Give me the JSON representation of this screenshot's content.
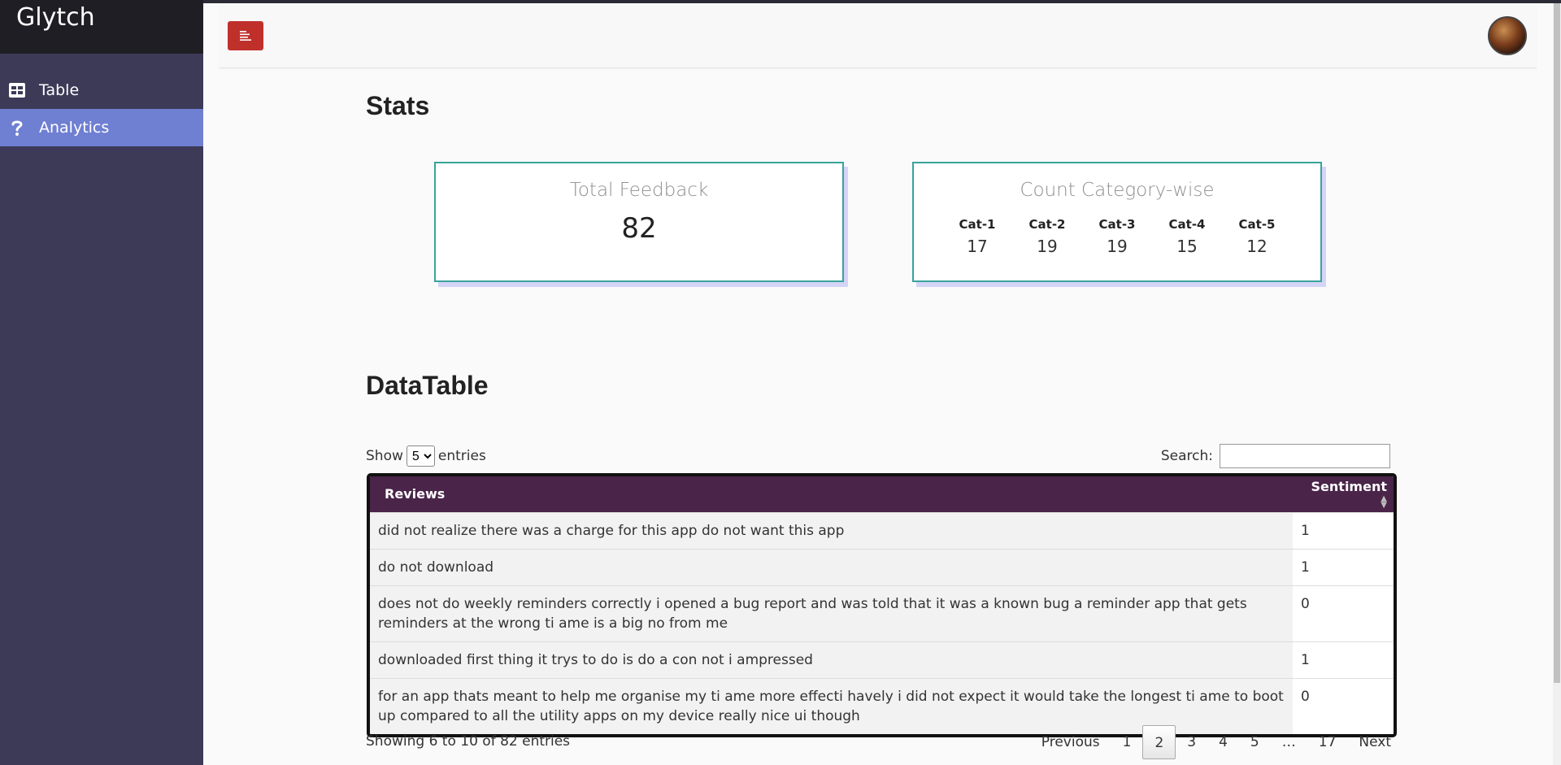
{
  "app": {
    "brand": "Glytch"
  },
  "sidebar": {
    "items": [
      {
        "label": "Table",
        "icon": "table-icon",
        "active": false
      },
      {
        "label": "Analytics",
        "icon": "question-icon",
        "active": true
      }
    ]
  },
  "stats": {
    "title": "Stats",
    "total_feedback": {
      "title": "Total Feedback",
      "value": "82"
    },
    "category": {
      "title": "Count Category-wise",
      "items": [
        {
          "label": "Cat-1",
          "value": "17"
        },
        {
          "label": "Cat-2",
          "value": "19"
        },
        {
          "label": "Cat-3",
          "value": "19"
        },
        {
          "label": "Cat-4",
          "value": "15"
        },
        {
          "label": "Cat-5",
          "value": "12"
        }
      ]
    }
  },
  "datatable": {
    "title": "DataTable",
    "show_label": "Show",
    "entries_label": "entries",
    "page_length": "5",
    "page_length_options": [
      "5"
    ],
    "search_label": "Search:",
    "search_value": "",
    "columns": [
      "Reviews",
      "Sentiment"
    ],
    "rows": [
      {
        "review": "did not realize there was a charge for this app do not want this app",
        "sentiment": "1"
      },
      {
        "review": "do not download",
        "sentiment": "1"
      },
      {
        "review": "does not do weekly reminders correctly i opened a bug report and was told that it was a known bug a reminder app that gets reminders at the wrong ti ame is a big no from me",
        "sentiment": "0"
      },
      {
        "review": "downloaded first thing it trys to do is do a con not i ampressed",
        "sentiment": "1"
      },
      {
        "review": "for an app thats meant to help me organise my ti ame more effecti havely i did not expect it would take the longest ti ame to boot up compared to all the utility apps on my device really nice ui though",
        "sentiment": "0"
      }
    ],
    "info": "Showing 6 to 10 of 82 entries",
    "pagination": {
      "previous": "Previous",
      "next": "Next",
      "pages": [
        "1",
        "2",
        "3",
        "4",
        "5",
        "…",
        "17"
      ],
      "active": "2"
    }
  },
  "colors": {
    "sidebar_bg": "#3c3a57",
    "active_nav": "#6f7fd2",
    "menu_button": "#c0302b",
    "table_header": "#4a2449",
    "card_border": "#39a39a"
  }
}
